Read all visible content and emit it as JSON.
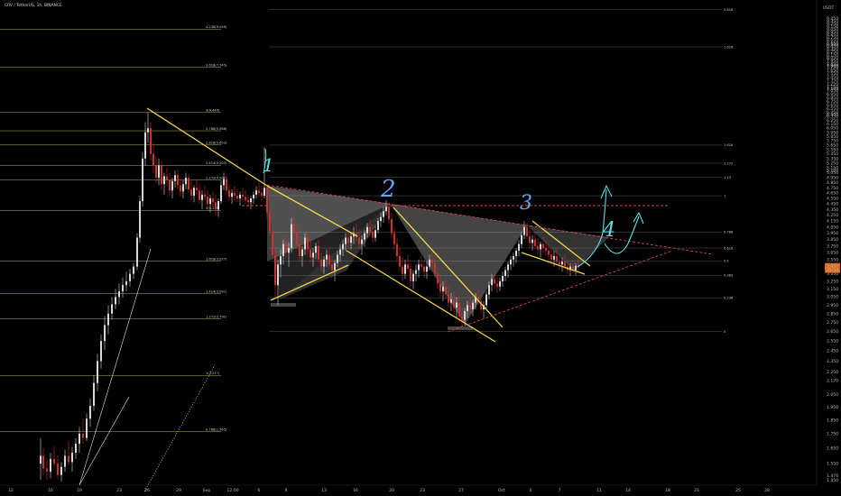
{
  "chart_data": {
    "type": "candlestick",
    "title": "CRV / TetherUS, 1h, BINANCE",
    "currency_label": "USDT",
    "price_range": [
      1.42,
      10.0
    ],
    "y_ticks": [
      "9.250",
      "8.500",
      "7.800",
      "7.100",
      "6.400",
      "5.750",
      "5.100",
      "4.450",
      "3.850",
      "3.250",
      "2.650",
      "2.050",
      "1.450",
      "1.476",
      "1.550",
      "1.650",
      "1.750",
      "1.850",
      "1.950",
      "2.050",
      "2.170",
      "2.250",
      "2.350",
      "2.450",
      "2.550",
      "2.650",
      "2.750",
      "2.850",
      "2.950",
      "3.050",
      "3.150",
      "3.250",
      "3.350",
      "3.450",
      "3.550",
      "3.650",
      "3.750",
      "3.850",
      "3.950",
      "4.050",
      "4.150",
      "4.250",
      "4.350",
      "4.450",
      "4.550",
      "4.650",
      "4.750",
      "4.850",
      "4.950",
      "5.050",
      "5.150",
      "5.250",
      "5.350",
      "5.450",
      "5.550",
      "5.650",
      "5.750",
      "5.850",
      "5.950",
      "6.050",
      "6.150",
      "6.250",
      "6.350",
      "6.450",
      "6.550",
      "6.650",
      "6.750",
      "6.850",
      "6.950",
      "7.050",
      "7.150",
      "7.250",
      "7.350",
      "7.450",
      "7.550",
      "7.650",
      "7.750",
      "7.850",
      "7.950",
      "8.050",
      "8.150",
      "8.250",
      "8.350",
      "8.450",
      "8.550",
      "8.650",
      "8.750",
      "8.850",
      "8.950",
      "9.050",
      "9.150",
      "9.250",
      "9.350",
      "9.450",
      "9.550",
      "9.650",
      "9.750",
      "9.850",
      "9.950"
    ],
    "x_ticks": [
      "12",
      "16",
      "19",
      "23",
      "26",
      "29",
      "Sep",
      "12:00",
      "6",
      "9",
      "13",
      "16",
      "20",
      "23",
      "27",
      "Oct",
      "4",
      "7",
      "11",
      "14",
      "18",
      "21",
      "25",
      "28"
    ],
    "current_price": "3.437",
    "current_price_sub": "35:58",
    "fib_left": [
      {
        "label": "4.236(9.049)",
        "price": 9.049
      },
      {
        "label": "3.618(7.745)",
        "price": 7.745
      },
      {
        "label": "3(6.449)",
        "price": 6.449
      },
      {
        "label": "2.786(5.988)",
        "price": 5.988
      },
      {
        "label": "2.618(5.653)",
        "price": 5.653
      },
      {
        "label": "2.414(5.203)",
        "price": 5.203
      },
      {
        "label": "2.272(4.901)",
        "price": 4.901
      },
      {
        "label": "2(4.335)",
        "price": 4.335
      },
      {
        "label": "1.618(3.527)",
        "price": 3.527
      },
      {
        "label": "1.414(3.091)",
        "price": 3.091
      },
      {
        "label": "1.272(2.791)",
        "price": 2.791
      },
      {
        "label": "1(2.217)",
        "price": 2.217
      },
      {
        "label": "0.786(1.765)",
        "price": 1.765
      }
    ],
    "fib_right": [
      {
        "label": "2.618",
        "price": 9.8
      },
      {
        "label": "1.618",
        "price": 8.42
      },
      {
        "label": "1.618",
        "price": 5.65
      },
      {
        "label": "1.272",
        "price": 5.25
      },
      {
        "label": "1.13",
        "price": 4.96
      },
      {
        "label": "1",
        "price": 4.6
      },
      {
        "label": "0.786",
        "price": 3.97
      },
      {
        "label": "0.618",
        "price": 3.72
      },
      {
        "label": "0.5",
        "price": 3.53
      },
      {
        "label": "0.382",
        "price": 3.33
      },
      {
        "label": "0.236",
        "price": 3.04
      },
      {
        "label": "0",
        "price": 2.65
      }
    ],
    "annotations": [
      "1",
      "2",
      "3",
      "4"
    ],
    "candles": [
      [
        45,
        1.55,
        1.72,
        1.45,
        1.6
      ],
      [
        48,
        1.6,
        1.65,
        1.48,
        1.52
      ],
      [
        52,
        1.52,
        1.58,
        1.45,
        1.5
      ],
      [
        56,
        1.5,
        1.62,
        1.46,
        1.58
      ],
      [
        60,
        1.58,
        1.66,
        1.52,
        1.55
      ],
      [
        64,
        1.55,
        1.6,
        1.46,
        1.48
      ],
      [
        68,
        1.48,
        1.56,
        1.44,
        1.53
      ],
      [
        72,
        1.53,
        1.64,
        1.5,
        1.6
      ],
      [
        76,
        1.6,
        1.7,
        1.54,
        1.56
      ],
      [
        80,
        1.56,
        1.66,
        1.5,
        1.62
      ],
      [
        84,
        1.62,
        1.72,
        1.58,
        1.68
      ],
      [
        88,
        1.68,
        1.8,
        1.62,
        1.75
      ],
      [
        92,
        1.75,
        1.86,
        1.68,
        1.72
      ],
      [
        96,
        1.72,
        1.9,
        1.7,
        1.86
      ],
      [
        100,
        1.86,
        2.02,
        1.8,
        1.96
      ],
      [
        104,
        1.96,
        2.22,
        1.92,
        2.15
      ],
      [
        108,
        2.15,
        2.42,
        2.08,
        2.35
      ],
      [
        112,
        2.35,
        2.62,
        2.28,
        2.55
      ],
      [
        116,
        2.55,
        2.82,
        2.46,
        2.72
      ],
      [
        120,
        2.72,
        2.95,
        2.62,
        2.85
      ],
      [
        124,
        2.85,
        3.05,
        2.78,
        2.96
      ],
      [
        128,
        2.96,
        3.15,
        2.9,
        3.05
      ],
      [
        132,
        3.05,
        3.22,
        2.96,
        3.12
      ],
      [
        136,
        3.12,
        3.3,
        3.04,
        3.2
      ],
      [
        140,
        3.2,
        3.38,
        3.12,
        3.25
      ],
      [
        144,
        3.25,
        3.42,
        3.18,
        3.35
      ],
      [
        148,
        3.35,
        3.5,
        3.28,
        3.45
      ],
      [
        152,
        3.45,
        3.95,
        3.4,
        3.88
      ],
      [
        155,
        3.88,
        4.6,
        3.8,
        4.5
      ],
      [
        158,
        4.5,
        5.5,
        4.4,
        5.35
      ],
      [
        161,
        5.35,
        6.2,
        5.2,
        5.95
      ],
      [
        164,
        5.95,
        6.45,
        5.7,
        6.05
      ],
      [
        167,
        6.05,
        6.2,
        5.3,
        5.45
      ],
      [
        170,
        5.45,
        5.7,
        5.05,
        5.2
      ],
      [
        173,
        5.2,
        5.4,
        4.85,
        4.95
      ],
      [
        176,
        4.95,
        5.35,
        4.8,
        5.2
      ],
      [
        179,
        5.2,
        5.3,
        4.7,
        4.82
      ],
      [
        182,
        4.82,
        5.05,
        4.62,
        4.98
      ],
      [
        185,
        4.98,
        5.15,
        4.78,
        4.9
      ],
      [
        188,
        4.9,
        5.05,
        4.6,
        4.7
      ],
      [
        191,
        4.7,
        4.95,
        4.55,
        4.88
      ],
      [
        194,
        4.88,
        5.1,
        4.75,
        5.0
      ],
      [
        197,
        5.0,
        5.12,
        4.72,
        4.8
      ],
      [
        200,
        4.8,
        4.95,
        4.58,
        4.68
      ],
      [
        203,
        4.68,
        4.9,
        4.55,
        4.82
      ],
      [
        206,
        4.82,
        5.05,
        4.72,
        4.95
      ],
      [
        209,
        4.95,
        5.02,
        4.65,
        4.72
      ],
      [
        212,
        4.72,
        4.88,
        4.52,
        4.6
      ],
      [
        215,
        4.6,
        4.8,
        4.48,
        4.75
      ],
      [
        218,
        4.75,
        4.92,
        4.62,
        4.7
      ],
      [
        221,
        4.7,
        4.82,
        4.45,
        4.52
      ],
      [
        224,
        4.52,
        4.7,
        4.35,
        4.62
      ],
      [
        227,
        4.62,
        4.78,
        4.5,
        4.58
      ],
      [
        230,
        4.58,
        4.7,
        4.38,
        4.45
      ],
      [
        233,
        4.45,
        4.62,
        4.3,
        4.55
      ],
      [
        236,
        4.55,
        4.68,
        4.4,
        4.48
      ],
      [
        239,
        4.48,
        4.62,
        4.25,
        4.35
      ],
      [
        242,
        4.35,
        4.55,
        4.22,
        4.5
      ],
      [
        245,
        4.5,
        4.9,
        4.45,
        4.8
      ],
      [
        248,
        4.8,
        5.05,
        4.7,
        4.92
      ],
      [
        251,
        4.92,
        5.0,
        4.62,
        4.7
      ],
      [
        254,
        4.7,
        4.82,
        4.5,
        4.58
      ],
      [
        257,
        4.58,
        4.72,
        4.45,
        4.65
      ],
      [
        260,
        4.65,
        4.78,
        4.52,
        4.6
      ],
      [
        263,
        4.6,
        4.72,
        4.48,
        4.55
      ],
      [
        266,
        4.55,
        4.68,
        4.42,
        4.62
      ],
      [
        269,
        4.62,
        4.75,
        4.5,
        4.58
      ],
      [
        272,
        4.58,
        4.7,
        4.45,
        4.52
      ],
      [
        275,
        4.52,
        4.62,
        4.38,
        4.48
      ],
      [
        278,
        4.48,
        4.6,
        4.35,
        4.55
      ],
      [
        281,
        4.55,
        4.68,
        4.45,
        4.62
      ],
      [
        284,
        4.62,
        4.78,
        4.55,
        4.7
      ],
      [
        287,
        4.7,
        4.85,
        4.58,
        4.65
      ],
      [
        290,
        4.65,
        4.78,
        4.5,
        4.6
      ],
      [
        293,
        4.6,
        5.6,
        4.55,
        4.75
      ],
      [
        296,
        4.75,
        4.8,
        4.2,
        4.3
      ],
      [
        299,
        4.3,
        4.4,
        3.9,
        3.98
      ],
      [
        302,
        3.98,
        4.05,
        3.55,
        3.62
      ],
      [
        305,
        3.62,
        3.75,
        3.05,
        3.2
      ],
      [
        308,
        3.2,
        3.55,
        2.95,
        3.48
      ],
      [
        311,
        3.48,
        3.7,
        3.3,
        3.6
      ],
      [
        314,
        3.6,
        3.85,
        3.48,
        3.78
      ],
      [
        317,
        3.78,
        3.92,
        3.55,
        3.65
      ],
      [
        320,
        3.65,
        3.8,
        3.45,
        3.72
      ],
      [
        323,
        3.72,
        4.2,
        3.65,
        4.1
      ],
      [
        326,
        4.1,
        4.25,
        3.85,
        3.95
      ],
      [
        329,
        3.95,
        4.05,
        3.7,
        3.78
      ],
      [
        332,
        3.78,
        3.9,
        3.52,
        3.6
      ],
      [
        335,
        3.6,
        3.75,
        3.45,
        3.7
      ],
      [
        338,
        3.7,
        3.95,
        3.62,
        3.88
      ],
      [
        341,
        3.88,
        3.95,
        3.62,
        3.7
      ],
      [
        344,
        3.7,
        3.82,
        3.5,
        3.58
      ],
      [
        347,
        3.58,
        3.72,
        3.45,
        3.65
      ],
      [
        350,
        3.65,
        3.8,
        3.55,
        3.75
      ],
      [
        353,
        3.75,
        3.85,
        3.5,
        3.55
      ],
      [
        356,
        3.55,
        3.65,
        3.38,
        3.45
      ],
      [
        359,
        3.45,
        3.6,
        3.35,
        3.55
      ],
      [
        362,
        3.55,
        3.7,
        3.45,
        3.62
      ],
      [
        365,
        3.62,
        3.72,
        3.42,
        3.48
      ],
      [
        368,
        3.48,
        3.6,
        3.3,
        3.4
      ],
      [
        371,
        3.4,
        3.55,
        3.25,
        3.5
      ],
      [
        374,
        3.5,
        3.68,
        3.44,
        3.62
      ],
      [
        377,
        3.62,
        3.78,
        3.52,
        3.7
      ],
      [
        380,
        3.7,
        3.85,
        3.6,
        3.78
      ],
      [
        383,
        3.78,
        3.95,
        3.68,
        3.88
      ],
      [
        386,
        3.88,
        4.0,
        3.72,
        3.8
      ],
      [
        389,
        3.8,
        3.95,
        3.7,
        3.9
      ],
      [
        392,
        3.9,
        4.05,
        3.78,
        3.95
      ],
      [
        395,
        3.95,
        4.1,
        3.82,
        3.88
      ],
      [
        398,
        3.88,
        4.02,
        3.7,
        3.78
      ],
      [
        401,
        3.78,
        3.92,
        3.62,
        3.85
      ],
      [
        404,
        3.85,
        4.0,
        3.74,
        3.95
      ],
      [
        407,
        3.95,
        4.12,
        3.88,
        4.05
      ],
      [
        410,
        4.05,
        4.18,
        3.9,
        3.98
      ],
      [
        413,
        3.98,
        4.1,
        3.8,
        3.88
      ],
      [
        416,
        3.88,
        4.08,
        3.82,
        4.0
      ],
      [
        419,
        4.0,
        4.2,
        3.95,
        4.15
      ],
      [
        422,
        4.15,
        4.3,
        4.05,
        4.22
      ],
      [
        425,
        4.22,
        4.4,
        4.12,
        4.32
      ],
      [
        428,
        4.32,
        4.52,
        4.25,
        4.4
      ],
      [
        431,
        4.4,
        4.48,
        4.1,
        4.18
      ],
      [
        434,
        4.18,
        4.28,
        3.88,
        3.95
      ],
      [
        437,
        3.95,
        4.05,
        3.7,
        3.78
      ],
      [
        440,
        3.78,
        3.88,
        3.52,
        3.6
      ],
      [
        443,
        3.6,
        3.72,
        3.38,
        3.45
      ],
      [
        446,
        3.45,
        3.58,
        3.25,
        3.35
      ],
      [
        449,
        3.35,
        3.55,
        3.28,
        3.48
      ],
      [
        452,
        3.48,
        3.62,
        3.38,
        3.42
      ],
      [
        455,
        3.42,
        3.5,
        3.18,
        3.25
      ],
      [
        458,
        3.25,
        3.4,
        3.15,
        3.35
      ],
      [
        461,
        3.35,
        3.48,
        3.25,
        3.4
      ],
      [
        464,
        3.4,
        3.55,
        3.3,
        3.48
      ],
      [
        467,
        3.48,
        3.6,
        3.38,
        3.45
      ],
      [
        470,
        3.45,
        3.55,
        3.3,
        3.38
      ],
      [
        473,
        3.38,
        3.52,
        3.28,
        3.45
      ],
      [
        476,
        3.45,
        3.62,
        3.4,
        3.55
      ],
      [
        479,
        3.55,
        3.68,
        3.42,
        3.5
      ],
      [
        482,
        3.5,
        3.6,
        3.3,
        3.35
      ],
      [
        485,
        3.35,
        3.45,
        3.15,
        3.22
      ],
      [
        488,
        3.22,
        3.32,
        3.05,
        3.12
      ],
      [
        491,
        3.12,
        3.25,
        3.0,
        3.18
      ],
      [
        494,
        3.18,
        3.28,
        3.02,
        3.08
      ],
      [
        497,
        3.08,
        3.18,
        2.92,
        2.98
      ],
      [
        500,
        2.98,
        3.1,
        2.88,
        3.02
      ],
      [
        503,
        3.02,
        3.12,
        2.85,
        2.92
      ],
      [
        506,
        2.92,
        3.05,
        2.8,
        2.98
      ],
      [
        509,
        2.98,
        3.08,
        2.75,
        2.82
      ],
      [
        512,
        2.82,
        2.92,
        2.7,
        2.78
      ],
      [
        515,
        2.78,
        2.92,
        2.72,
        2.88
      ],
      [
        518,
        2.88,
        3.0,
        2.8,
        2.95
      ],
      [
        521,
        2.95,
        3.05,
        2.85,
        2.9
      ],
      [
        524,
        2.9,
        3.02,
        2.82,
        2.98
      ],
      [
        527,
        2.98,
        3.1,
        2.9,
        3.05
      ],
      [
        530,
        3.05,
        3.15,
        2.95,
        3.0
      ],
      [
        533,
        3.0,
        3.08,
        2.85,
        2.9
      ],
      [
        536,
        2.9,
        3.0,
        2.8,
        2.95
      ],
      [
        539,
        2.95,
        3.12,
        2.9,
        3.08
      ],
      [
        542,
        3.08,
        3.25,
        3.02,
        3.2
      ],
      [
        545,
        3.2,
        3.35,
        3.12,
        3.28
      ],
      [
        548,
        3.28,
        3.4,
        3.15,
        3.22
      ],
      [
        551,
        3.22,
        3.32,
        3.1,
        3.18
      ],
      [
        554,
        3.18,
        3.3,
        3.12,
        3.25
      ],
      [
        557,
        3.25,
        3.38,
        3.18,
        3.32
      ],
      [
        560,
        3.32,
        3.45,
        3.25,
        3.4
      ],
      [
        563,
        3.4,
        3.52,
        3.3,
        3.48
      ],
      [
        566,
        3.48,
        3.6,
        3.4,
        3.55
      ],
      [
        569,
        3.55,
        3.65,
        3.45,
        3.6
      ],
      [
        572,
        3.6,
        3.72,
        3.5,
        3.68
      ],
      [
        575,
        3.68,
        3.85,
        3.6,
        3.78
      ],
      [
        578,
        3.78,
        3.98,
        3.72,
        3.92
      ],
      [
        581,
        3.92,
        4.15,
        3.85,
        4.05
      ],
      [
        584,
        4.05,
        4.12,
        3.85,
        3.9
      ],
      [
        587,
        3.9,
        4.0,
        3.72,
        3.8
      ],
      [
        590,
        3.8,
        3.92,
        3.68,
        3.85
      ],
      [
        593,
        3.85,
        3.95,
        3.7,
        3.75
      ],
      [
        596,
        3.75,
        3.88,
        3.62,
        3.7
      ],
      [
        599,
        3.7,
        3.82,
        3.58,
        3.78
      ],
      [
        602,
        3.78,
        3.9,
        3.65,
        3.72
      ],
      [
        605,
        3.72,
        3.85,
        3.6,
        3.68
      ],
      [
        608,
        3.68,
        3.78,
        3.55,
        3.62
      ],
      [
        611,
        3.62,
        3.72,
        3.48,
        3.55
      ],
      [
        614,
        3.55,
        3.68,
        3.45,
        3.6
      ],
      [
        617,
        3.6,
        3.7,
        3.48,
        3.52
      ],
      [
        620,
        3.52,
        3.62,
        3.4,
        3.48
      ],
      [
        623,
        3.48,
        3.58,
        3.38,
        3.52
      ],
      [
        626,
        3.52,
        3.62,
        3.42,
        3.45
      ],
      [
        629,
        3.45,
        3.55,
        3.35,
        3.4
      ],
      [
        632,
        3.4,
        3.5,
        3.32,
        3.45
      ],
      [
        635,
        3.45,
        3.55,
        3.36,
        3.4
      ],
      [
        638,
        3.4,
        3.5,
        3.33,
        3.46
      ],
      [
        641,
        3.46,
        3.55,
        3.38,
        3.44
      ]
    ]
  }
}
